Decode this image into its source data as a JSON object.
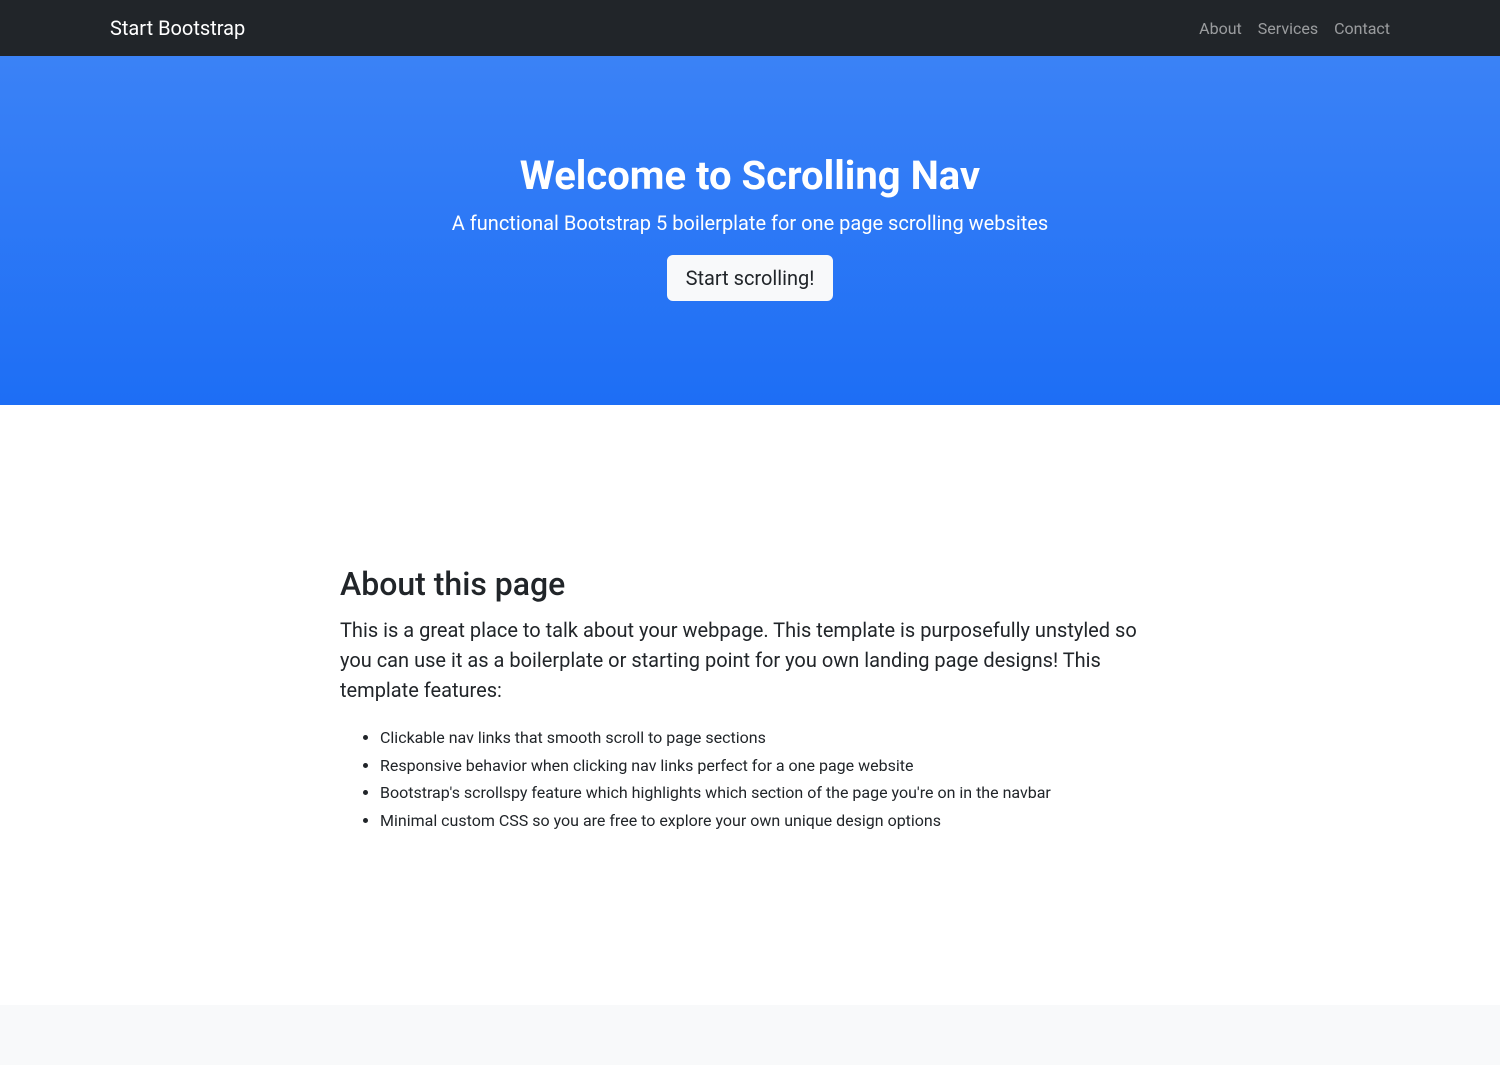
{
  "nav": {
    "brand": "Start Bootstrap",
    "links": [
      {
        "label": "About"
      },
      {
        "label": "Services"
      },
      {
        "label": "Contact"
      }
    ]
  },
  "hero": {
    "title": "Welcome to Scrolling Nav",
    "subtitle": "A functional Bootstrap 5 boilerplate for one page scrolling websites",
    "cta_label": "Start scrolling!"
  },
  "about": {
    "heading": "About this page",
    "lead": "This is a great place to talk about your webpage. This template is purposefully unstyled so you can use it as a boilerplate or starting point for you own landing page designs! This template features:",
    "features": [
      "Clickable nav links that smooth scroll to page sections",
      "Responsive behavior when clicking nav links perfect for a one page website",
      "Bootstrap's scrollspy feature which highlights which section of the page you're on in the navbar",
      "Minimal custom CSS so you are free to explore your own unique design options"
    ]
  }
}
